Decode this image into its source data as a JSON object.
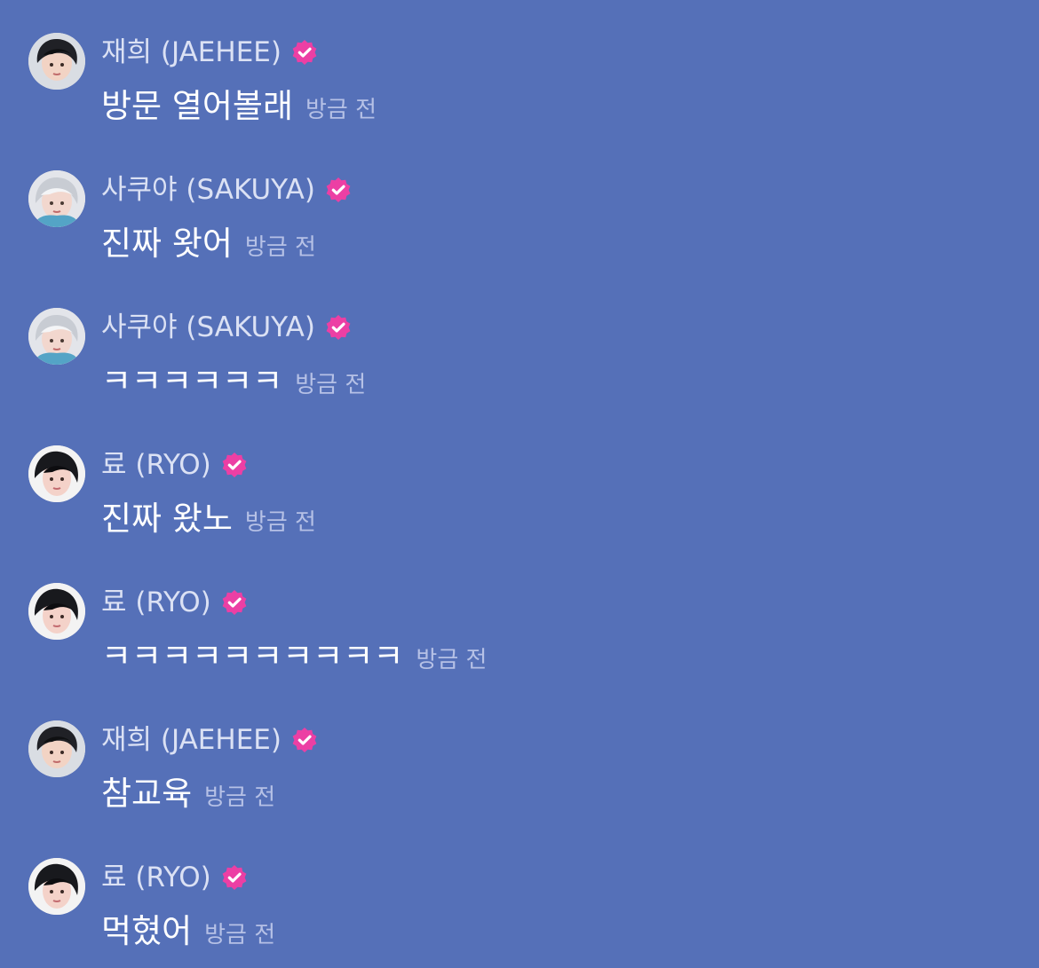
{
  "messages": [
    {
      "author": "재희 (JAEHEE)",
      "avatar": "jaehee-avatar",
      "text": "방문 열어볼래",
      "time": "방금 전"
    },
    {
      "author": "사쿠야 (SAKUYA)",
      "avatar": "sakuya-avatar",
      "text": "진짜 왓어",
      "time": "방금 전"
    },
    {
      "author": "사쿠야 (SAKUYA)",
      "avatar": "sakuya-avatar",
      "text": "ㅋㅋㅋㅋㅋㅋ",
      "time": "방금 전"
    },
    {
      "author": "료 (RYO)",
      "avatar": "ryo-avatar",
      "text": "진짜 왔노",
      "time": "방금 전"
    },
    {
      "author": "료 (RYO)",
      "avatar": "ryo-avatar",
      "text": "ㅋㅋㅋㅋㅋㅋㅋㅋㅋㅋ",
      "time": "방금 전"
    },
    {
      "author": "재희 (JAEHEE)",
      "avatar": "jaehee-avatar",
      "text": "참교육",
      "time": "방금 전"
    },
    {
      "author": "료 (RYO)",
      "avatar": "ryo-avatar",
      "text": "먹혔어",
      "time": "방금 전"
    }
  ],
  "icons": {
    "verified": "verified-badge-icon"
  },
  "colors": {
    "background": "#5570b8",
    "author_text": "#dbe1f4",
    "message_text": "#ffffff",
    "timestamp_text": "#b6c1e6",
    "verified_badge": "#ec3fa4"
  }
}
